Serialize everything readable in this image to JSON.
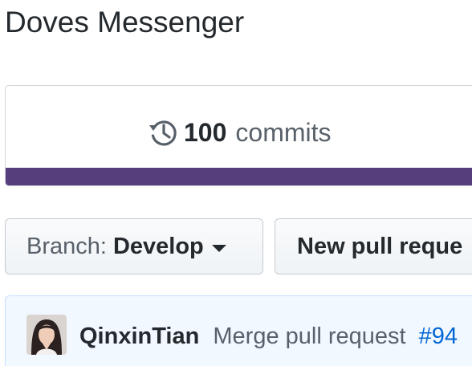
{
  "repo": {
    "title": "Doves Messenger"
  },
  "summary": {
    "commits_icon": "history-icon",
    "commits_count": "100",
    "commits_label": "commits",
    "language_bar": [
      {
        "color": "#563d7c",
        "fraction": 1.0
      }
    ]
  },
  "toolbar": {
    "branch_prefix": "Branch:",
    "branch_name": "Develop",
    "branch_caret_icon": "triangle-down-icon",
    "new_pr_label": "New pull reque"
  },
  "latest_commit": {
    "author": "QinxinTian",
    "message": "Merge pull request",
    "pr_ref": "#94",
    "avatar_icon": "user-avatar"
  },
  "colors": {
    "link": "#0366d6",
    "commit_bar_bg": "#f1f8ff",
    "commit_bar_border": "#c8e1ff",
    "language": "#563d7c"
  }
}
